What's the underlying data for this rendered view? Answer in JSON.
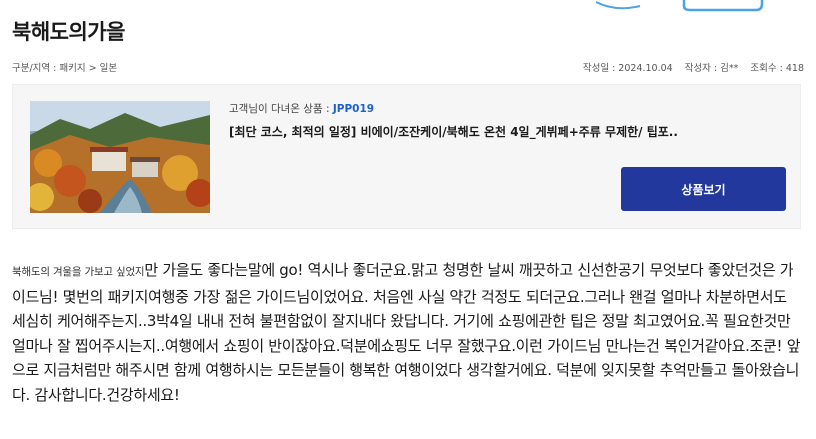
{
  "page": {
    "title": "북해도의가을",
    "breadcrumb": "구분/지역 : 패키지 > 일본"
  },
  "meta": {
    "date": "작성일 : 2024.10.04",
    "author": "작성자 : 김**",
    "views": "조회수 : 418"
  },
  "product": {
    "label": "고객님이 다녀온 상품 :",
    "code": "JPP019",
    "name": "[최단 코스, 최적의 일정] 비에이/조잔케이/북해도 온천 4일_게뷔페+주류 무제한/ 팁포..",
    "button_label": "상품보기",
    "image_icon": "autumn-valley-photo"
  },
  "review": {
    "lead": "북해도의 겨울을 가보고 싶었지",
    "body": "만 가을도 좋다는말에 go! 역시나 좋더군요.맑고 청명한 날씨 깨끗하고 신선한공기  무엇보다 좋았던것은 가이드님! 몇번의 패키지여행중 가장 젊은 가이드님이었어요. 처음엔 사실 약간 걱정도 되더군요.그러나 왠걸  얼마나 차분하면서도 세심히  케어해주는지..3박4일 내내 전혀 불편함없이 잘지내다 왔답니다. 거기에 쇼핑에관한 팁은 정말 최고였어요.꼭 필요한것만 얼마나 잘 찝어주시는지..여행에서 쇼핑이 반이잖아요.덕분에쇼핑도 너무 잘했구요.이런 가이드님 만나는건 복인거같아요.조쿤! 앞으로 지금처럼만 해주시면 함께 여행하시는 모든분들이 행복한 여행이었다 생각할거에요. 덕분에 잊지못할 추억만들고 돌아왔습니다. 감사합니다.건강하세요!"
  },
  "colors": {
    "accent": "#1e5fc8",
    "button": "#23389c",
    "box_bg": "#f6f6f6"
  }
}
